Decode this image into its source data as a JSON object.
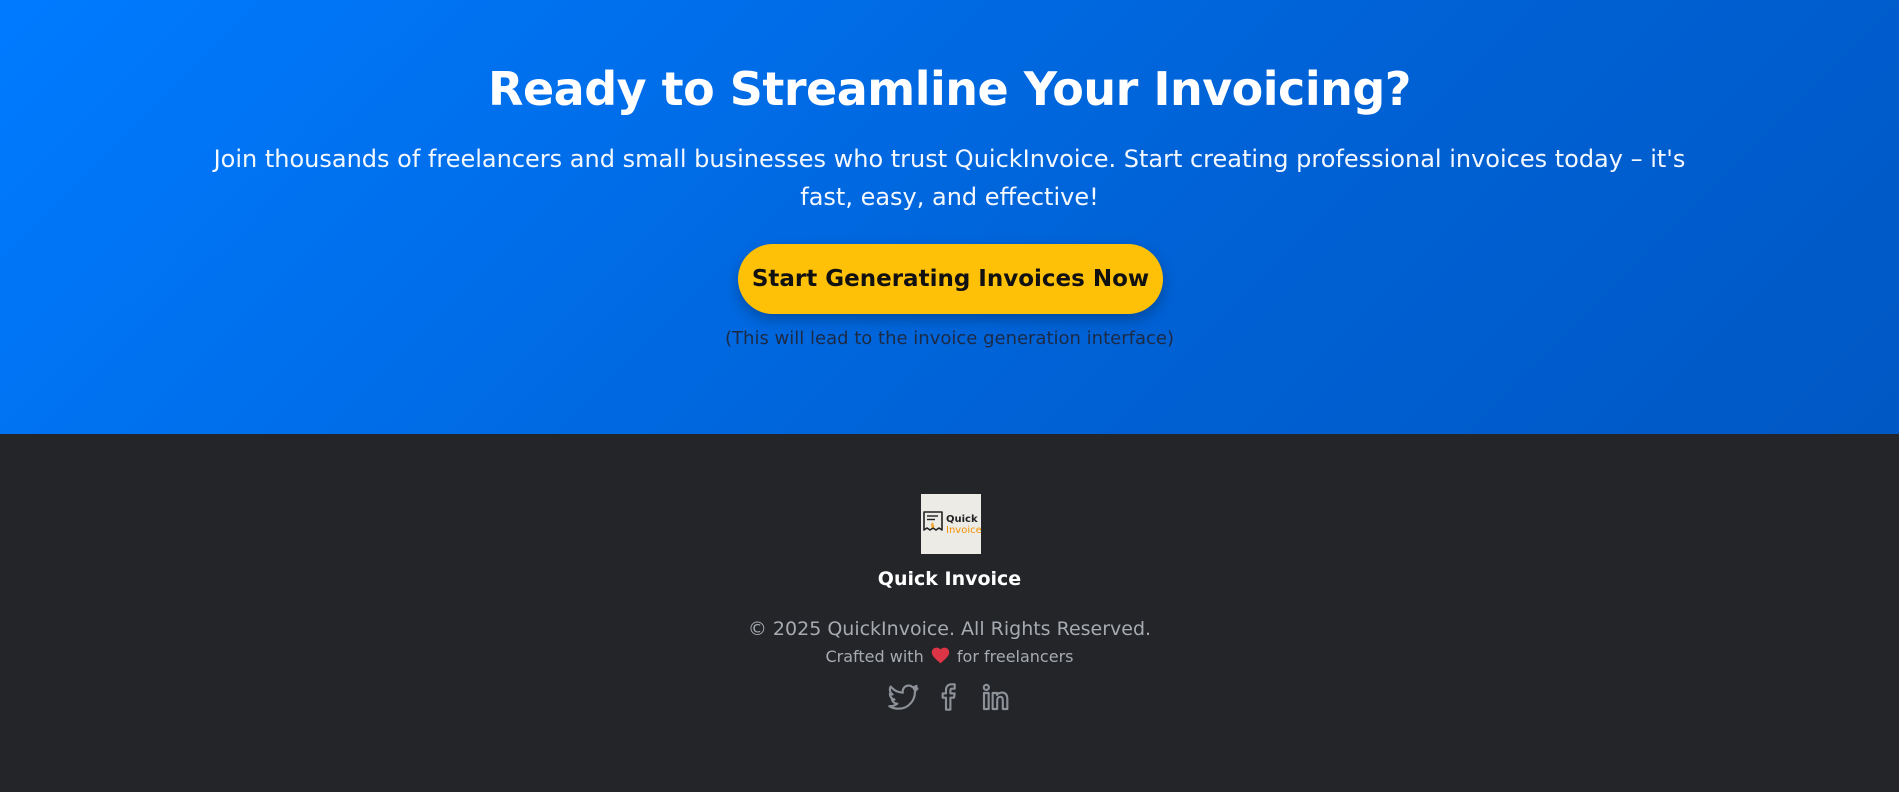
{
  "cta": {
    "title": "Ready to Streamline Your Invoicing?",
    "description": "Join thousands of freelancers and small businesses who trust QuickInvoice. Start creating professional invoices today – it's fast, easy, and effective!",
    "button_label": "Start Generating Invoices Now",
    "note": "(This will lead to the invoice generation interface)"
  },
  "footer": {
    "logo": {
      "line1": "Quick",
      "line2": "Invoice",
      "icon": "invoice-receipt-icon"
    },
    "brand_name": "Quick Invoice",
    "copyright": "© 2025 QuickInvoice. All Rights Reserved.",
    "crafted_prefix": "Crafted with",
    "crafted_suffix": "for freelancers",
    "heart_icon": "heart-icon",
    "socials": [
      {
        "name": "twitter",
        "icon": "twitter-icon"
      },
      {
        "name": "facebook",
        "icon": "facebook-icon"
      },
      {
        "name": "linkedin",
        "icon": "linkedin-icon"
      }
    ]
  },
  "colors": {
    "primary_blue": "#007bff",
    "button_yellow": "#ffc107",
    "footer_bg": "#232528",
    "muted_text": "#a7abb1",
    "heart_red": "#dc3545",
    "logo_orange": "#f39200"
  }
}
